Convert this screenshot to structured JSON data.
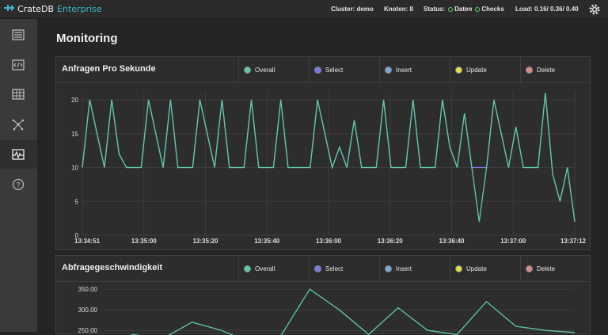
{
  "app": {
    "brand_name": "CrateDB",
    "brand_edition": "Enterprise"
  },
  "header": {
    "cluster": "Cluster: demo",
    "nodes": "Knoten: 8",
    "status_label": "Status:",
    "status_data": "Daten",
    "status_checks": "Checks",
    "load": "Load: 0.16/ 0.36/ 0.40"
  },
  "sidebar": {
    "items": [
      {
        "icon": "overview-icon"
      },
      {
        "icon": "console-icon"
      },
      {
        "icon": "tables-icon"
      },
      {
        "icon": "cluster-icon"
      },
      {
        "icon": "monitoring-icon",
        "active": true
      },
      {
        "icon": "help-icon"
      }
    ]
  },
  "page": {
    "title": "Monitoring"
  },
  "legend": [
    {
      "label": "Overall",
      "color": "#5ec9a6"
    },
    {
      "label": "Select",
      "color": "#7b78e8"
    },
    {
      "label": "Insert",
      "color": "#7aa6dc"
    },
    {
      "label": "Update",
      "color": "#e6dd4a"
    },
    {
      "label": "Delete",
      "color": "#d98a86"
    }
  ],
  "panels": {
    "qps": {
      "title": "Anfragen Pro Sekunde"
    },
    "speed": {
      "title": "Abfragegeschwindigkeit"
    }
  },
  "chart_data": [
    {
      "type": "line",
      "title": "Anfragen Pro Sekunde",
      "ylim": [
        0,
        20
      ],
      "yticks": [
        "0",
        "5",
        "10",
        "15",
        "20"
      ],
      "xticks": [
        "13:34:51",
        "13:35:00",
        "13:35:20",
        "13:35:40",
        "13:36:00",
        "13:36:20",
        "13:36:40",
        "13:37:00",
        "13:37:12"
      ],
      "grid": true,
      "series": [
        {
          "name": "Overall",
          "color": "#5ec9a6",
          "values": [
            10,
            20,
            15,
            10,
            20,
            12,
            10,
            10,
            10,
            20,
            15,
            10,
            20,
            10,
            10,
            10,
            20,
            15,
            10,
            20,
            10,
            10,
            10,
            20,
            10,
            10,
            10,
            20,
            10,
            10,
            10,
            10,
            20,
            15,
            10,
            13,
            10,
            17,
            10,
            10,
            10,
            20,
            10,
            10,
            10,
            20,
            10,
            10,
            10,
            20,
            13,
            10,
            18,
            10,
            2,
            10,
            20,
            15,
            10,
            16,
            10,
            10,
            10,
            21,
            9,
            5,
            10,
            2
          ]
        },
        {
          "name": "Select",
          "color": "#7b78e8",
          "values": [
            10,
            20,
            15,
            10,
            20,
            12,
            10,
            10,
            10,
            20,
            15,
            10,
            20,
            10,
            10,
            10,
            20,
            15,
            10,
            20,
            10,
            10,
            10,
            20,
            10,
            10,
            10,
            20,
            10,
            10,
            10,
            10,
            20,
            15,
            10,
            13,
            10,
            17,
            10,
            10,
            10,
            20,
            10,
            10,
            10,
            20,
            10,
            10,
            10,
            20,
            13,
            10,
            18,
            10,
            10,
            10,
            20,
            15,
            10,
            16,
            10,
            10,
            10,
            21,
            9,
            5,
            10,
            2
          ]
        }
      ]
    },
    {
      "type": "line",
      "title": "Abfragegeschwindigkeit",
      "yticks": [
        "350.00",
        "300.00",
        "250.00"
      ],
      "series": [
        {
          "name": "Overall",
          "color": "#5ec9a6",
          "values": [
            220,
            240,
            230,
            270,
            250,
            220,
            235,
            350,
            300,
            240,
            305,
            250,
            240,
            320,
            260,
            250,
            245
          ]
        }
      ]
    }
  ]
}
